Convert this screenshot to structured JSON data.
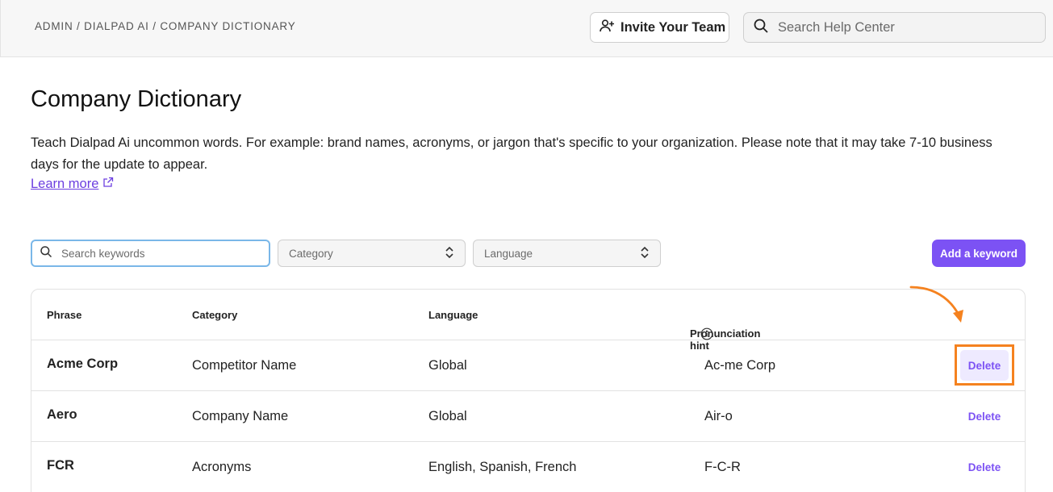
{
  "header": {
    "breadcrumb": "ADMIN / DIALPAD AI / COMPANY DICTIONARY",
    "invite_label": "Invite Your Team",
    "help_search_placeholder": "Search Help Center"
  },
  "main": {
    "title": "Company Dictionary",
    "description": "Teach Dialpad Ai uncommon words. For example: brand names, acronyms, or jargon that's specific to your organization. Please note that it may take 7-10 business days for the update to appear.",
    "learn_more": "Learn more"
  },
  "filters": {
    "search_placeholder": "Search keywords",
    "category_placeholder": "Category",
    "language_placeholder": "Language",
    "add_label": "Add a keyword"
  },
  "table": {
    "headers": {
      "phrase": "Phrase",
      "category": "Category",
      "language": "Language",
      "hint": "Pronunciation hint"
    },
    "rows": [
      {
        "phrase": "Acme Corp",
        "category": "Competitor Name",
        "language": "Global",
        "hint": "Ac-me Corp",
        "action": "Delete"
      },
      {
        "phrase": "Aero",
        "category": "Company Name",
        "language": "Global",
        "hint": "Air-o",
        "action": "Delete"
      },
      {
        "phrase": "FCR",
        "category": "Acronyms",
        "language": "English, Spanish, French",
        "hint": "F-C-R",
        "action": "Delete"
      }
    ]
  },
  "colors": {
    "accent": "#7c52f4",
    "annotation": "#f5821f",
    "focus_border": "#7ab7e8"
  },
  "icons": [
    "add-user-icon",
    "search-icon",
    "external-link-icon",
    "chevron-updown-icon",
    "info-icon",
    "annotation-arrow"
  ]
}
